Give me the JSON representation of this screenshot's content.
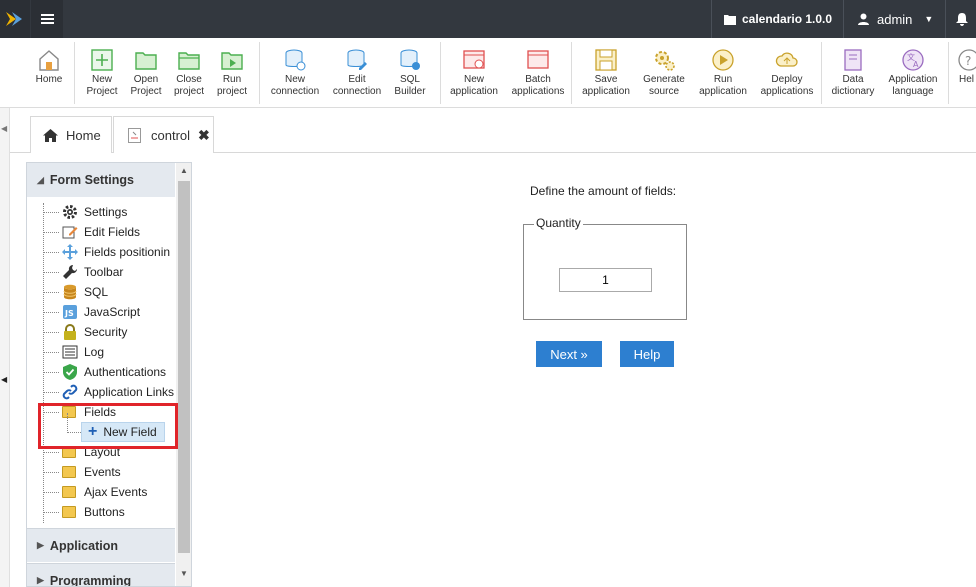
{
  "topbar": {
    "app_name": "calendario 1.0.0",
    "user": "admin"
  },
  "toolbar": {
    "buttons": [
      {
        "label1": "Home",
        "label2": "",
        "icon": "home-icon"
      },
      {
        "label1": "New",
        "label2": "Project",
        "icon": "new-project-icon"
      },
      {
        "label1": "Open",
        "label2": "Project",
        "icon": "open-folder-icon"
      },
      {
        "label1": "Close",
        "label2": "project",
        "icon": "close-folder-icon"
      },
      {
        "label1": "Run",
        "label2": "project",
        "icon": "run-project-icon"
      },
      {
        "label1": "New",
        "label2": "connection",
        "icon": "new-connection-icon"
      },
      {
        "label1": "Edit",
        "label2": "connection",
        "icon": "edit-connection-icon"
      },
      {
        "label1": "SQL",
        "label2": "Builder",
        "icon": "sql-builder-icon"
      },
      {
        "label1": "New",
        "label2": "application",
        "icon": "new-application-icon"
      },
      {
        "label1": "Batch",
        "label2": "applications",
        "icon": "batch-applications-icon"
      },
      {
        "label1": "Save",
        "label2": "application",
        "icon": "save-icon"
      },
      {
        "label1": "Generate",
        "label2": "source",
        "icon": "generate-source-icon"
      },
      {
        "label1": "Run",
        "label2": "application",
        "icon": "run-application-icon"
      },
      {
        "label1": "Deploy",
        "label2": "applications",
        "icon": "deploy-icon"
      },
      {
        "label1": "Data",
        "label2": "dictionary",
        "icon": "data-dictionary-icon"
      },
      {
        "label1": "Application",
        "label2": "language",
        "icon": "language-icon"
      },
      {
        "label1": "Hel",
        "label2": "",
        "icon": "help-icon"
      }
    ]
  },
  "tabs": {
    "home": "Home",
    "control": "control"
  },
  "sidepanel": {
    "form_settings": "Form Settings",
    "items": [
      {
        "label": "Settings",
        "icon": "gear-icon"
      },
      {
        "label": "Edit Fields",
        "icon": "edit-fields-icon"
      },
      {
        "label": "Fields positionin",
        "icon": "move-icon"
      },
      {
        "label": "Toolbar",
        "icon": "wrench-icon"
      },
      {
        "label": "SQL",
        "icon": "database-icon"
      },
      {
        "label": "JavaScript",
        "icon": "javascript-icon"
      },
      {
        "label": "Security",
        "icon": "lock-icon"
      },
      {
        "label": "Log",
        "icon": "log-icon"
      },
      {
        "label": "Authentications",
        "icon": "shield-check-icon"
      },
      {
        "label": "Application Links",
        "icon": "link-icon"
      },
      {
        "label": "Fields",
        "icon": "folder-icon"
      },
      {
        "label": "Layout",
        "icon": "folder-icon"
      },
      {
        "label": "Events",
        "icon": "folder-icon"
      },
      {
        "label": "Ajax Events",
        "icon": "folder-icon"
      },
      {
        "label": "Buttons",
        "icon": "folder-icon"
      }
    ],
    "new_field": "New Field",
    "application": "Application",
    "programming": "Programming"
  },
  "main": {
    "define_label": "Define the amount of fields:",
    "legend": "Quantity",
    "quantity_value": "1",
    "next_label": "Next »",
    "help_label": "Help"
  },
  "colors": {
    "topbar": "#33383f",
    "button": "#2d7fd0",
    "highlight": "#e0242a"
  }
}
